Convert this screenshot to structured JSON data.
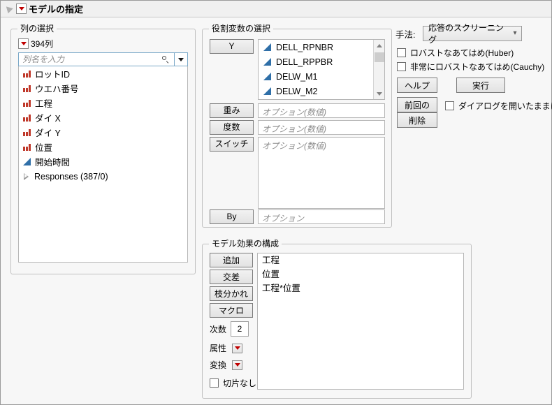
{
  "window": {
    "title": "モデルの指定",
    "disclosure_icon": "triangle-down-icon",
    "menu_icon": "red-dropdown-icon"
  },
  "columns_panel": {
    "legend": "列の選択",
    "count_label": "394列",
    "count_menu_icon": "red-dropdown-icon",
    "search": {
      "placeholder": "列名を入力",
      "search_icon": "search-icon",
      "dropdown_icon": "chevron-down-icon"
    },
    "items": [
      {
        "label": "ロットID",
        "type": "nominal"
      },
      {
        "label": "ウエハ番号",
        "type": "nominal"
      },
      {
        "label": "工程",
        "type": "nominal"
      },
      {
        "label": "ダイ X",
        "type": "nominal"
      },
      {
        "label": "ダイ Y",
        "type": "nominal"
      },
      {
        "label": "位置",
        "type": "nominal"
      },
      {
        "label": "開始時間",
        "type": "continuous"
      },
      {
        "label": "Responses (387/0)",
        "type": "group"
      }
    ]
  },
  "roles_panel": {
    "legend": "役割変数の選択",
    "y": {
      "button": "Y",
      "items": [
        {
          "label": "DELL_RPNBR",
          "type": "continuous"
        },
        {
          "label": "DELL_RPPBR",
          "type": "continuous"
        },
        {
          "label": "DELW_M1",
          "type": "continuous"
        },
        {
          "label": "DELW_M2",
          "type": "continuous"
        }
      ],
      "scroll_up_icon": "chevron-up-icon",
      "scroll_down_icon": "chevron-down-icon"
    },
    "weight": {
      "button": "重み",
      "placeholder": "オプション(数値)"
    },
    "freq": {
      "button": "度数",
      "placeholder": "オプション(数値)"
    },
    "switch": {
      "button": "スイッチ",
      "placeholder": "オプション(数値)"
    },
    "by": {
      "button": "By",
      "placeholder": "オプション"
    }
  },
  "method_panel": {
    "label": "手法:",
    "selected": "応答のスクリーニング",
    "dropdown_icon": "chevron-down-icon",
    "checkboxes": [
      {
        "label": "ロバストなあてはめ(Huber)",
        "checked": false
      },
      {
        "label": "非常にロバストなあてはめ(Cauchy)",
        "checked": false
      }
    ],
    "buttons": {
      "help": "ヘルプ",
      "run": "実行",
      "recall": "前回の設定",
      "remove": "削除"
    },
    "keep_open": {
      "label": "ダイアログを開いたままにする",
      "checked": false
    }
  },
  "effects_panel": {
    "legend": "モデル効果の構成",
    "buttons": {
      "add": "追加",
      "cross": "交差",
      "nest": "枝分かれ",
      "macro": "マクロ"
    },
    "degree": {
      "label": "次数",
      "value": "2"
    },
    "attributes": {
      "label": "属性",
      "icon": "red-dropdown-icon"
    },
    "transform": {
      "label": "変換",
      "icon": "red-dropdown-icon"
    },
    "no_intercept": {
      "label": "切片なし",
      "checked": false
    },
    "effects": [
      "工程",
      "位置",
      "工程*位置"
    ]
  }
}
